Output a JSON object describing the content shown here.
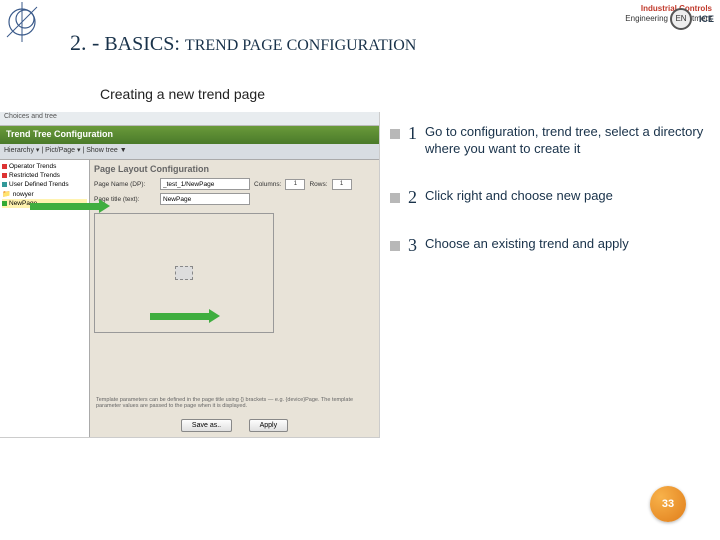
{
  "header": {
    "dept_line1": "Industrial Controls",
    "dept_line2": "Engineering Department",
    "enice_en": "EN",
    "enice_label": "ICE"
  },
  "title": {
    "number": "2. -",
    "main": "BASICS",
    "sep": ":",
    "rest": "TREND PAGE CONFIGURATION"
  },
  "subtitle": "Creating a new trend page",
  "app": {
    "menu": "Choices and tree",
    "window_title": "Trend Tree Configuration",
    "toolbar": "Hierarchy ▾ | Pict/Page ▾ | Show tree ▼",
    "tree": {
      "items": [
        {
          "label": "Operator Trends",
          "cls": "red"
        },
        {
          "label": "Restricted Trends",
          "cls": "red"
        },
        {
          "label": "User Defined Trends",
          "cls": "teal"
        },
        {
          "label": "nowyer",
          "cls": "folder"
        },
        {
          "label": "NewPage",
          "cls": "green",
          "selected": true
        }
      ]
    },
    "config": {
      "header": "Page Layout Configuration",
      "page_name_label": "Page Name (DP):",
      "page_name_value": "_test_1/NewPage",
      "columns_label": "Columns:",
      "columns_value": "1",
      "rows_label": "Rows:",
      "rows_value": "1",
      "page_title_label": "Page title (text):",
      "page_title_value": "NewPage",
      "hint": "Template parameters can be defined in the page title using {} brackets — e.g. {device}Page. The template parameter values are passed to the page when it is displayed.",
      "btn_saveas": "Save as..",
      "btn_apply": "Apply"
    }
  },
  "steps": [
    {
      "n": "1",
      "text": "Go to configuration, trend tree, select a directory where you want to create it"
    },
    {
      "n": "2",
      "text": "Click right and choose new page"
    },
    {
      "n": "3",
      "text": "Choose an existing trend and apply"
    }
  ],
  "page_number": "33"
}
